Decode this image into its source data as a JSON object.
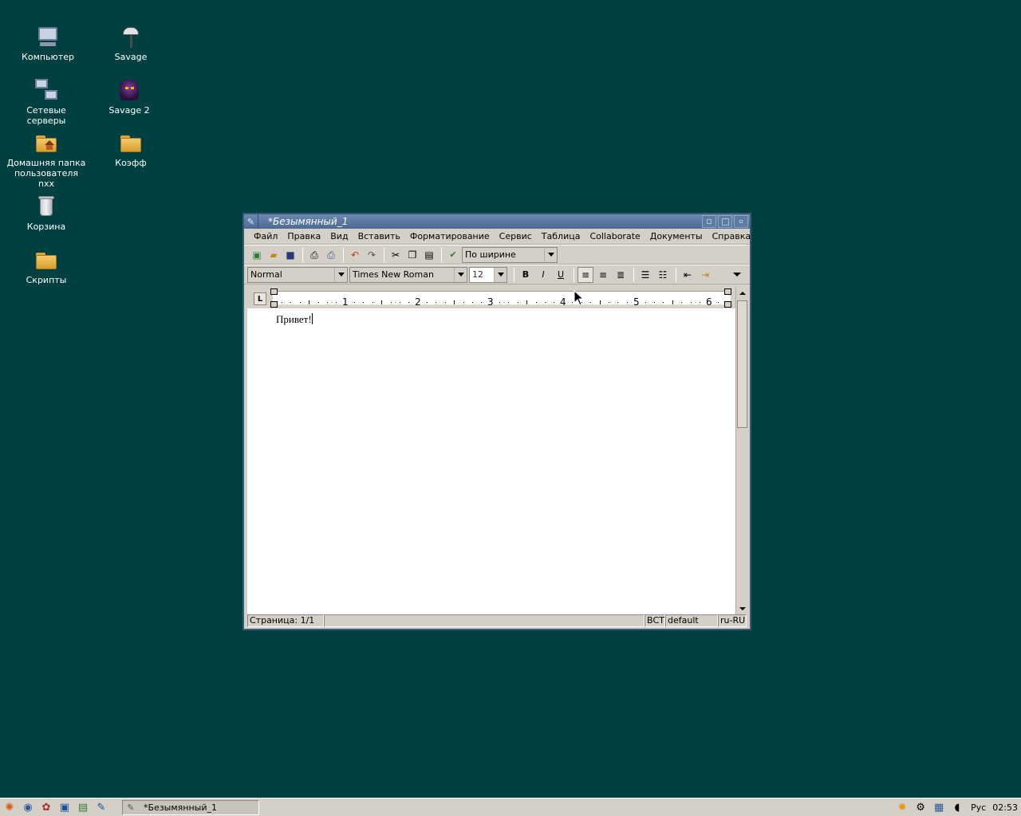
{
  "desktop": {
    "icons": [
      {
        "label": "Компьютер",
        "icon": "computer-icon"
      },
      {
        "label": "Savage",
        "icon": "axe-icon"
      },
      {
        "label": "Сетевые серверы",
        "icon": "network-servers-icon"
      },
      {
        "label": "Savage 2",
        "icon": "savage2-icon"
      },
      {
        "label": "Домашняя папка пользователя nxx",
        "icon": "home-folder-icon"
      },
      {
        "label": "Коэфф",
        "icon": "folder-icon"
      },
      {
        "label": "Корзина",
        "icon": "trash-icon"
      },
      {
        "label": "Скрипты",
        "icon": "folder-icon"
      }
    ]
  },
  "window": {
    "title": "*Безымянный_1",
    "menu": [
      "Файл",
      "Правка",
      "Вид",
      "Вставить",
      "Форматирование",
      "Сервис",
      "Таблица",
      "Collaborate",
      "Документы",
      "Справка"
    ],
    "toolbar": {
      "align_combo": "По ширине"
    },
    "format": {
      "style": "Normal",
      "font": "Times New Roman",
      "size": "12",
      "bold": "B",
      "italic": "I",
      "underline": "U"
    },
    "ruler": {
      "numbers": [
        "1",
        "2",
        "3",
        "4",
        "5",
        "6"
      ]
    },
    "document_text": "Привет!",
    "status": {
      "page": "Страница: 1/1",
      "mode": "ВСТ",
      "style": "default",
      "lang": "ru-RU"
    }
  },
  "taskbar": {
    "task_label": "*Безымянный_1",
    "lang": "Рус",
    "clock": "02:53"
  },
  "colors": {
    "desktop": "#004040",
    "titlebar": "#5577a0",
    "chrome": "#d4d0c8"
  }
}
